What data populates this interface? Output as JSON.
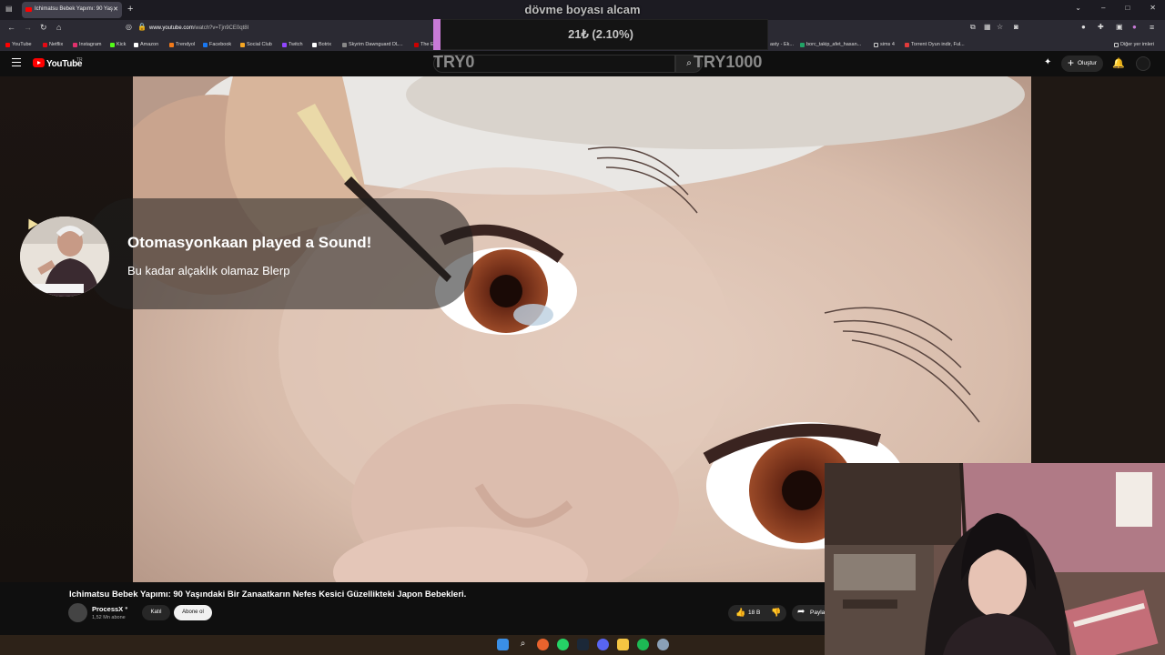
{
  "browser": {
    "tab_title": "Ichimatsu Bebek Yapımı: 90 Yaş",
    "url_host": "www.youtube.com",
    "url_path": "/watch?v=Tjn9CE0qt8I",
    "bookmarks": [
      {
        "label": "YouTube",
        "color": "#ff0000"
      },
      {
        "label": "Netflix",
        "color": "#e50914"
      },
      {
        "label": "Instagram",
        "color": "#e1306c"
      },
      {
        "label": "Kick",
        "color": "#53fc18"
      },
      {
        "label": "Amazon",
        "color": "#ffffff"
      },
      {
        "label": "Trendyol",
        "color": "#f27a1a"
      },
      {
        "label": "Facebook",
        "color": "#1877f2"
      },
      {
        "label": "Social Club",
        "color": "#f5a623"
      },
      {
        "label": "Twitch",
        "color": "#9146ff"
      },
      {
        "label": "Botrix",
        "color": "#ffffff"
      },
      {
        "label": "Skyrim Dawnguard DL...",
        "color": "#888888"
      },
      {
        "label": "The E",
        "color": "#cc0000"
      }
    ],
    "bookmarks_right": [
      {
        "label": "asty - Ek...",
        "color": "#888888"
      },
      {
        "label": "borc_takip_afet_hasan...",
        "color": "#21a366"
      },
      {
        "label": "sims 4",
        "color": "#cccccc"
      },
      {
        "label": "Torrent Oyun indir, Ful...",
        "color": "#e23b3b"
      }
    ],
    "other_bookmarks": "Diğer yer imleri"
  },
  "youtube": {
    "logo_text": "YouTube",
    "country_code": "TR",
    "create_label": "Oluştur"
  },
  "donation_goal": {
    "title": "dövme boyası alcam",
    "current": "21₺ (2.10%)",
    "progress_fraction": 0.021,
    "min_label": "TRY0",
    "max_label": "TRY1000",
    "accent": "#c77ad6"
  },
  "alert": {
    "title": "Otomasyonkaan played a Sound!",
    "message": "Bu kadar alçaklık olamaz Blerp"
  },
  "video": {
    "title": "Ichimatsu Bebek Yapımı: 90 Yaşındaki Bir Zanaatkarın Nefes Kesici Güzellikteki Japon Bebekleri.",
    "channel": "ProcessX",
    "subscribers": "1,52 Mn abone",
    "join_label": "Katıl",
    "subscribe_label": "Abone ol",
    "likes": "18 B",
    "share_label": "Paylaş"
  },
  "icons": {
    "tab_favicon": "youtube-favicon",
    "search": "search-icon",
    "bell": "bell-icon",
    "upload": "upload-icon"
  }
}
